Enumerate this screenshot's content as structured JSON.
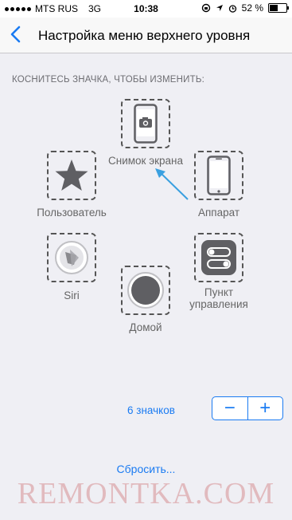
{
  "status_bar": {
    "carrier": "MTS RUS",
    "network": "3G",
    "time": "10:38",
    "battery_percent_label": "52 %",
    "battery_level": 0.52
  },
  "nav": {
    "title": "Настройка меню верхнего уровня"
  },
  "section_header": "КОСНИТЕСЬ ЗНАЧКА, ЧТОБЫ ИЗМЕНИТЬ:",
  "menu_items": {
    "screenshot": "Снимок экрана",
    "user": "Пользователь",
    "device": "Аппарат",
    "siri": "Siri",
    "control_center_line1": "Пункт",
    "control_center_line2": "управления",
    "home": "Домой"
  },
  "icon_count_label": "6 значков",
  "stepper": {
    "minus": "−",
    "plus": "+"
  },
  "reset_label": "Сбросить...",
  "watermark": "REMONTKA.COM",
  "colors": {
    "accent": "#1a7bf2",
    "icon_gray": "#5f5f63",
    "background": "#efeff4"
  }
}
